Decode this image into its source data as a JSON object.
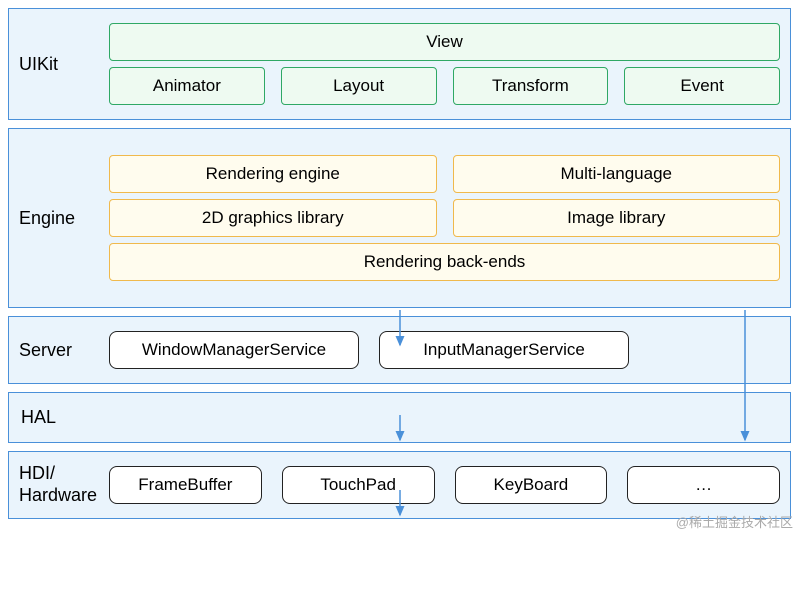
{
  "layers": {
    "uikit": {
      "label": "UIKit"
    },
    "engine": {
      "label": "Engine"
    },
    "server": {
      "label": "Server"
    },
    "hal": {
      "label": "HAL"
    },
    "hdi": {
      "label": "HDI/\nHardware"
    }
  },
  "uikit_boxes": {
    "view": "View",
    "animator": "Animator",
    "layout": "Layout",
    "transform": "Transform",
    "event": "Event"
  },
  "engine_boxes": {
    "rendering_engine": "Rendering engine",
    "multi_language": "Multi-language",
    "graphics2d": "2D graphics library",
    "image_library": "Image library",
    "rendering_backends": "Rendering back-ends"
  },
  "server_boxes": {
    "wms": "WindowManagerService",
    "ims": "InputManagerService"
  },
  "hdi_boxes": {
    "framebuffer": "FrameBuffer",
    "touchpad": "TouchPad",
    "keyboard": "KeyBoard",
    "more": "…"
  },
  "watermark": "@稀土掘金技术社区"
}
